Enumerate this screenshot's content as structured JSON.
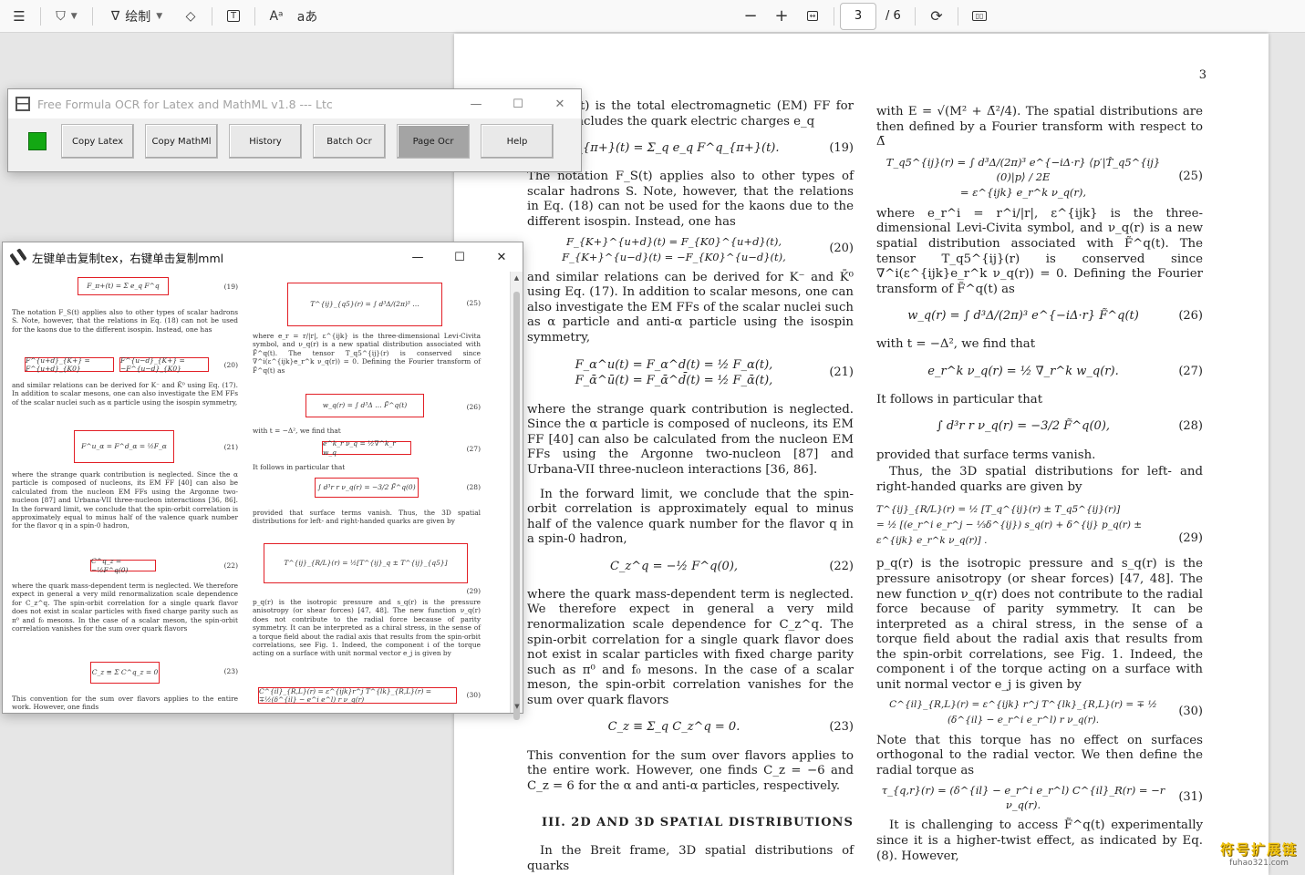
{
  "toolbar": {
    "draw_label": "绘制",
    "read_aloud_glyph": "Aᵃ",
    "translate_glyph": "aあ",
    "current_page": "3",
    "page_total": "/ 6"
  },
  "ocr_window": {
    "title": "Free Formula OCR for Latex and MathML v1.8  --- Ltc",
    "swatch_color": "#13a813",
    "buttons": [
      "Copy Latex",
      "Copy MathMl",
      "History",
      "Batch Ocr",
      "Page Ocr",
      "Help"
    ],
    "active_button": "Page Ocr"
  },
  "result_window": {
    "title": "左键单击复制tex，右键单击复制mml",
    "left_col": {
      "eq19": "(19)",
      "eq20": "(20)",
      "eq21": "(21)",
      "eq22": "(22)",
      "eq23": "(23)",
      "p1": "The notation F_S(t) applies also to other types of scalar hadrons S. Note, however, that the relations in Eq. (18) can not be used for the kaons due to the different isospin. Instead, one has",
      "p2": "and similar relations can be derived for K⁻ and K̄⁰ using Eq. (17). In addition to scalar mesons, one can also investigate the EM FFs of the scalar nuclei such as α particle using the isospin symmetry,",
      "p3": "where the strange quark contribution is neglected. Since the α particle is composed of nucleons, its EM FF [40] can also be calculated from the nucleon EM FFs using the Argonne two-nucleon [87] and Urbana-VII three-nucleon interactions [36, 86]. In the forward limit, we conclude that the spin-orbit correlation is approximately equal to minus half of the valence quark number for the flavor q in a spin-0 hadron,",
      "p4": "where the quark mass-dependent term is neglected. We therefore expect in general a very mild renormalization scale dependence for C_z^q. The spin-orbit correlation for a single quark flavor does not exist in scalar particles with fixed charge parity such as π⁰ and f₀ mesons. In the case of a scalar meson, the spin-orbit correlation vanishes for the sum over quark flavors",
      "p5": "This convention for the sum over flavors applies to the entire work. However, one finds"
    },
    "right_col": {
      "eq25": "(25)",
      "eq26": "(26)",
      "eq27": "(27)",
      "eq28": "(28)",
      "eq29": "(29)",
      "eq30": "(30)",
      "p1": "where e_r = r/|r|, ε^{ijk} is the three-dimensional Levi-Civita symbol, and ν_q(r) is a new spatial distribution associated with F̃^q(t). The tensor T_q5^{ij}(r) is conserved since ∇^i(ε^{ijk}e_r^k ν_q(r)) = 0. Defining the Fourier transform of F̃^q(t) as",
      "p2": "with t = −Δ², we find that",
      "p3": "It follows in particular that",
      "p4": "provided that surface terms vanish. Thus, the 3D spatial distributions for left- and right-handed quarks are given by",
      "p5": "p_q(r) is the isotropic pressure and s_q(r) is the pressure anisotropy (or shear forces) [47, 48]. The new function ν_q(r) does not contribute to the radial force because of parity symmetry. It can be interpreted as a chiral stress, in the sense of a torque field about the radial axis that results from the spin-orbit correlations, see Fig. 1. Indeed, the component i of the torque acting on a surface with unit normal vector e_j is given by"
    }
  },
  "document": {
    "page_number": "3",
    "left": {
      "p_top": "F_{π+}(t) is the total electromagnetic (EM) FF for π⁺ and includes the quark electric charges e_q",
      "eq19": "F_{π+}(t) = Σ_q e_q F^q_{π+}(t).",
      "eq19_num": "(19)",
      "p1": "The notation F_S(t) applies also to other types of scalar hadrons S. Note, however, that the relations in Eq. (18) can not be used for the kaons due to the different isospin. Instead, one has",
      "eq20": "F_{K+}^{u+d}(t) = F_{K0}^{u+d}(t),      F_{K+}^{u−d}(t) = −F_{K0}^{u−d}(t),",
      "eq20_num": "(20)",
      "p2": "and similar relations can be derived for K⁻ and K̄⁰ using Eq. (17). In addition to scalar mesons, one can also investigate the EM FFs of the scalar nuclei such as α particle and anti-α particle using the isospin symmetry,",
      "eq21a": "F_α^u(t) = F_α^d(t) = ½ F_α(t),",
      "eq21b": "F_ᾱ^ū(t) = F_ᾱ^d̄(t) = ½ F_ᾱ(t),",
      "eq21_num": "(21)",
      "p3": "where the strange quark contribution is neglected. Since the α particle is composed of nucleons, its EM FF [40] can also be calculated from the nucleon EM FFs using the Argonne two-nucleon [87] and Urbana-VII three-nucleon interactions [36, 86].",
      "p4": "In the forward limit, we conclude that the spin-orbit correlation is approximately equal to minus half of the valence quark number for the flavor q in a spin-0 hadron,",
      "eq22": "C_z^q = −½ F^q(0),",
      "eq22_num": "(22)",
      "p5": "where the quark mass-dependent term is neglected. We therefore expect in general a very mild renormalization scale dependence for C_z^q. The spin-orbit correlation for a single quark flavor does not exist in scalar particles with fixed charge parity such as π⁰ and f₀ mesons. In the case of a scalar meson, the spin-orbit correlation vanishes for the sum over quark flavors",
      "eq23": "C_z ≡ Σ_q C_z^q = 0.",
      "eq23_num": "(23)",
      "p6": "This convention for the sum over flavors applies to the entire work. However, one finds C_z = −6 and C_z = 6 for the α and anti-α particles, respectively.",
      "section": "III.   2D AND 3D SPATIAL DISTRIBUTIONS",
      "p7": "In the Breit frame, 3D spatial distributions of quarks"
    },
    "right": {
      "p1": "with E = √(M² + Δ̄²/4). The spatial distributions are then defined by a Fourier transform with respect to Δ̄",
      "eq25a": "T_q5^{ij}(r) = ∫ d³Δ/(2π)³ e^{−iΔ·r} ⟨p′|T̂_q5^{ij}(0)|p⟩ / 2E",
      "eq25b": "= ε^{ijk} e_r^k ν_q(r),",
      "eq25_num": "(25)",
      "p2": "where e_r^i = r^i/|r|, ε^{ijk} is the three-dimensional Levi-Civita symbol, and ν_q(r) is a new spatial distribution associated with F̃^q(t). The tensor T_q5^{ij}(r) is conserved since ∇^i(ε^{ijk}e_r^k ν_q(r)) = 0. Defining the Fourier transform of F̃^q(t) as",
      "eq26": "w_q(r) = ∫ d³Δ/(2π)³ e^{−iΔ·r} F̃^q(t)",
      "eq26_num": "(26)",
      "p3": "with t = −Δ², we find that",
      "eq27": "e_r^k ν_q(r) = ½ ∇_r^k w_q(r).",
      "eq27_num": "(27)",
      "p4": "It follows in particular that",
      "eq28": "∫ d³r r ν_q(r) = −3/2 F̃^q(0),",
      "eq28_num": "(28)",
      "p5": "provided that surface terms vanish.",
      "p6": "Thus, the 3D spatial distributions for left- and right-handed quarks are given by",
      "eq29a": "T^{ij}_{R/L}(r) = ½ [T_q^{ij}(r) ± T_q5^{ij}(r)]",
      "eq29b": "= ½ [(e_r^i e_r^j − ⅓δ^{ij}) s_q(r) + δ^{ij} p_q(r) ± ε^{ijk} e_r^k ν_q(r)] .",
      "eq29_num": "(29)",
      "p7": "p_q(r) is the isotropic pressure and s_q(r) is the pressure anisotropy (or shear forces) [47, 48]. The new function ν_q(r) does not contribute to the radial force because of parity symmetry. It can be interpreted as a chiral stress, in the sense of a torque field about the radial axis that results from the spin-orbit correlations, see Fig. 1. Indeed, the component i of the torque acting on a surface with unit normal vector e_j is given by",
      "eq30": "C^{il}_{R,L}(r) = ε^{ijk} r^j T^{lk}_{R,L}(r) = ∓ ½ (δ^{il} − e_r^i e_r^l) r ν_q(r).",
      "eq30_num": "(30)",
      "p8": "Note that this torque has no effect on surfaces orthogonal to the radial vector. We then define the radial torque as",
      "eq31": "τ_{q,r}(r) = (δ^{il} − e_r^i e_r^l) C^{il}_R(r) = −r ν_q(r).",
      "eq31_num": "(31)",
      "p9": "It is challenging to access F̃^q(t) experimentally since it is a higher-twist effect, as indicated by Eq. (8). However,"
    }
  },
  "watermark": {
    "text": "符号扩展链",
    "url": "fuhao321.com"
  }
}
